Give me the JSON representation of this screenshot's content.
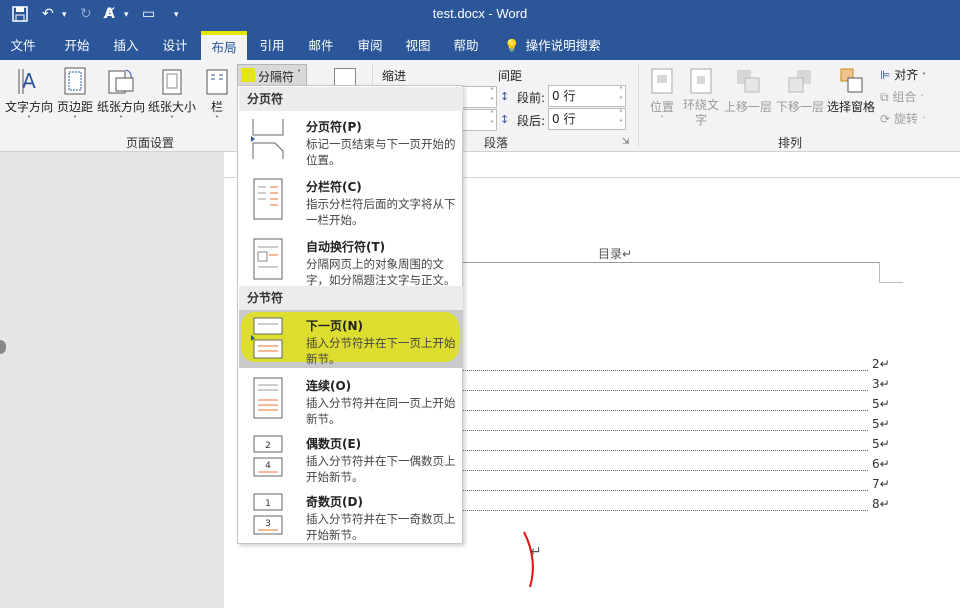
{
  "window": {
    "title": "test.docx  -  Word"
  },
  "tabs": [
    "文件",
    "开始",
    "插入",
    "设计",
    "布局",
    "引用",
    "邮件",
    "审阅",
    "视图",
    "帮助",
    "操作说明搜索"
  ],
  "ribbon": {
    "page_setup": {
      "buttons": [
        "文字方向",
        "页边距",
        "纸张方向",
        "纸张大小",
        "栏"
      ],
      "label": "页面设置"
    },
    "breaks_button": "分隔符",
    "indent_label": "缩进",
    "spacing_label": "间距",
    "spacing_before_label": "段前:",
    "spacing_before_value": "0 行",
    "spacing_after_label": "段后:",
    "spacing_after_value": "0 行",
    "paragraph_label": "段落",
    "arrange": {
      "buttons": [
        "位置",
        "环绕文字",
        "上移一层",
        "下移一层",
        "选择窗格"
      ],
      "align": "对齐",
      "group": "组合",
      "rotate": "旋转",
      "label": "排列"
    }
  },
  "menu": {
    "section_page": "分页符",
    "section_section": "分节符",
    "items": [
      {
        "title": "分页符(P)",
        "desc": "标记一页结束与下一页开始的位置。"
      },
      {
        "title": "分栏符(C)",
        "desc": "指示分栏符后面的文字将从下一栏开始。"
      },
      {
        "title": "自动换行符(T)",
        "desc": "分隔网页上的对象周围的文字，如分隔题注文字与正文。"
      },
      {
        "title": "下一页(N)",
        "desc": "插入分节符并在下一页上开始新节。"
      },
      {
        "title": "连续(O)",
        "desc": "插入分节符并在同一页上开始新节。"
      },
      {
        "title": "偶数页(E)",
        "desc": "插入分节符并在下一偶数页上开始新节。"
      },
      {
        "title": "奇数页(D)",
        "desc": "插入分节符并在下一奇数页上开始新节。"
      }
    ]
  },
  "document": {
    "header_text": "目录↵",
    "toc_numbers": [
      "2↵",
      "3↵",
      "5↵",
      "5↵",
      "5↵",
      "6↵",
      "7↵",
      "8↵"
    ]
  },
  "colors": {
    "brand": "#2b579a",
    "highlight": "#e6e600"
  }
}
